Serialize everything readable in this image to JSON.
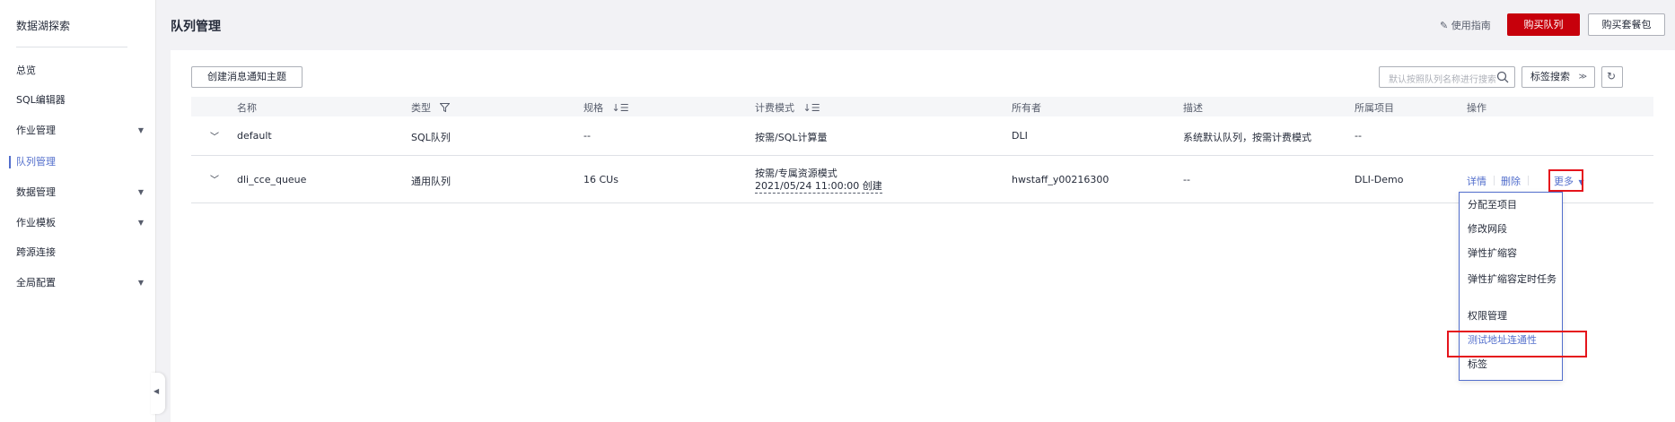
{
  "sidebar": {
    "title": "数据湖探索",
    "items": [
      {
        "label": "总览",
        "has_children": false,
        "active": false
      },
      {
        "label": "SQL编辑器",
        "has_children": false,
        "active": false
      },
      {
        "label": "作业管理",
        "has_children": true,
        "active": false
      },
      {
        "label": "队列管理",
        "has_children": false,
        "active": true
      },
      {
        "label": "数据管理",
        "has_children": true,
        "active": false
      },
      {
        "label": "作业模板",
        "has_children": true,
        "active": false
      },
      {
        "label": "跨源连接",
        "has_children": false,
        "active": false
      },
      {
        "label": "全局配置",
        "has_children": true,
        "active": false
      }
    ],
    "collapse_icon": "caret-left-icon"
  },
  "header": {
    "title": "队列管理",
    "guide_label": "使用指南",
    "buy_queue_label": "购买队列",
    "buy_package_label": "购买套餐包"
  },
  "toolbar": {
    "create_topic_label": "创建消息通知主题",
    "search_placeholder": "默认按照队列名称进行搜索",
    "tag_search_label": "标签搜索"
  },
  "table": {
    "columns": [
      "名称",
      "类型",
      "规格",
      "计费模式",
      "所有者",
      "描述",
      "所属项目",
      "操作"
    ],
    "rows": [
      {
        "name": "default",
        "type": "SQL队列",
        "spec": "--",
        "billing": "按需/SQL计算量",
        "billing_sub": "",
        "owner": "DLI",
        "description": "系统默认队列，按需计费模式",
        "project": "--",
        "actions": []
      },
      {
        "name": "dli_cce_queue",
        "type": "通用队列",
        "spec": "16 CUs",
        "billing": "按需/专属资源模式",
        "billing_sub": "2021/05/24 11:00:00 创建",
        "owner": "hwstaff_y00216300",
        "description": "--",
        "project": "DLI-Demo",
        "actions": [
          "详情",
          "删除",
          "更多"
        ]
      }
    ]
  },
  "more_menu": {
    "items": [
      {
        "label": "分配至项目"
      },
      {
        "label": "修改网段"
      },
      {
        "label": "弹性扩缩容"
      },
      {
        "label": "弹性扩缩容定时任务"
      },
      {
        "label": "权限管理"
      },
      {
        "label": "测试地址连通性",
        "highlighted": true
      },
      {
        "label": "标签"
      }
    ]
  },
  "colors": {
    "primary_red": "#c7000b",
    "link_blue": "#526ecc",
    "highlight_border": "#e5141c"
  }
}
